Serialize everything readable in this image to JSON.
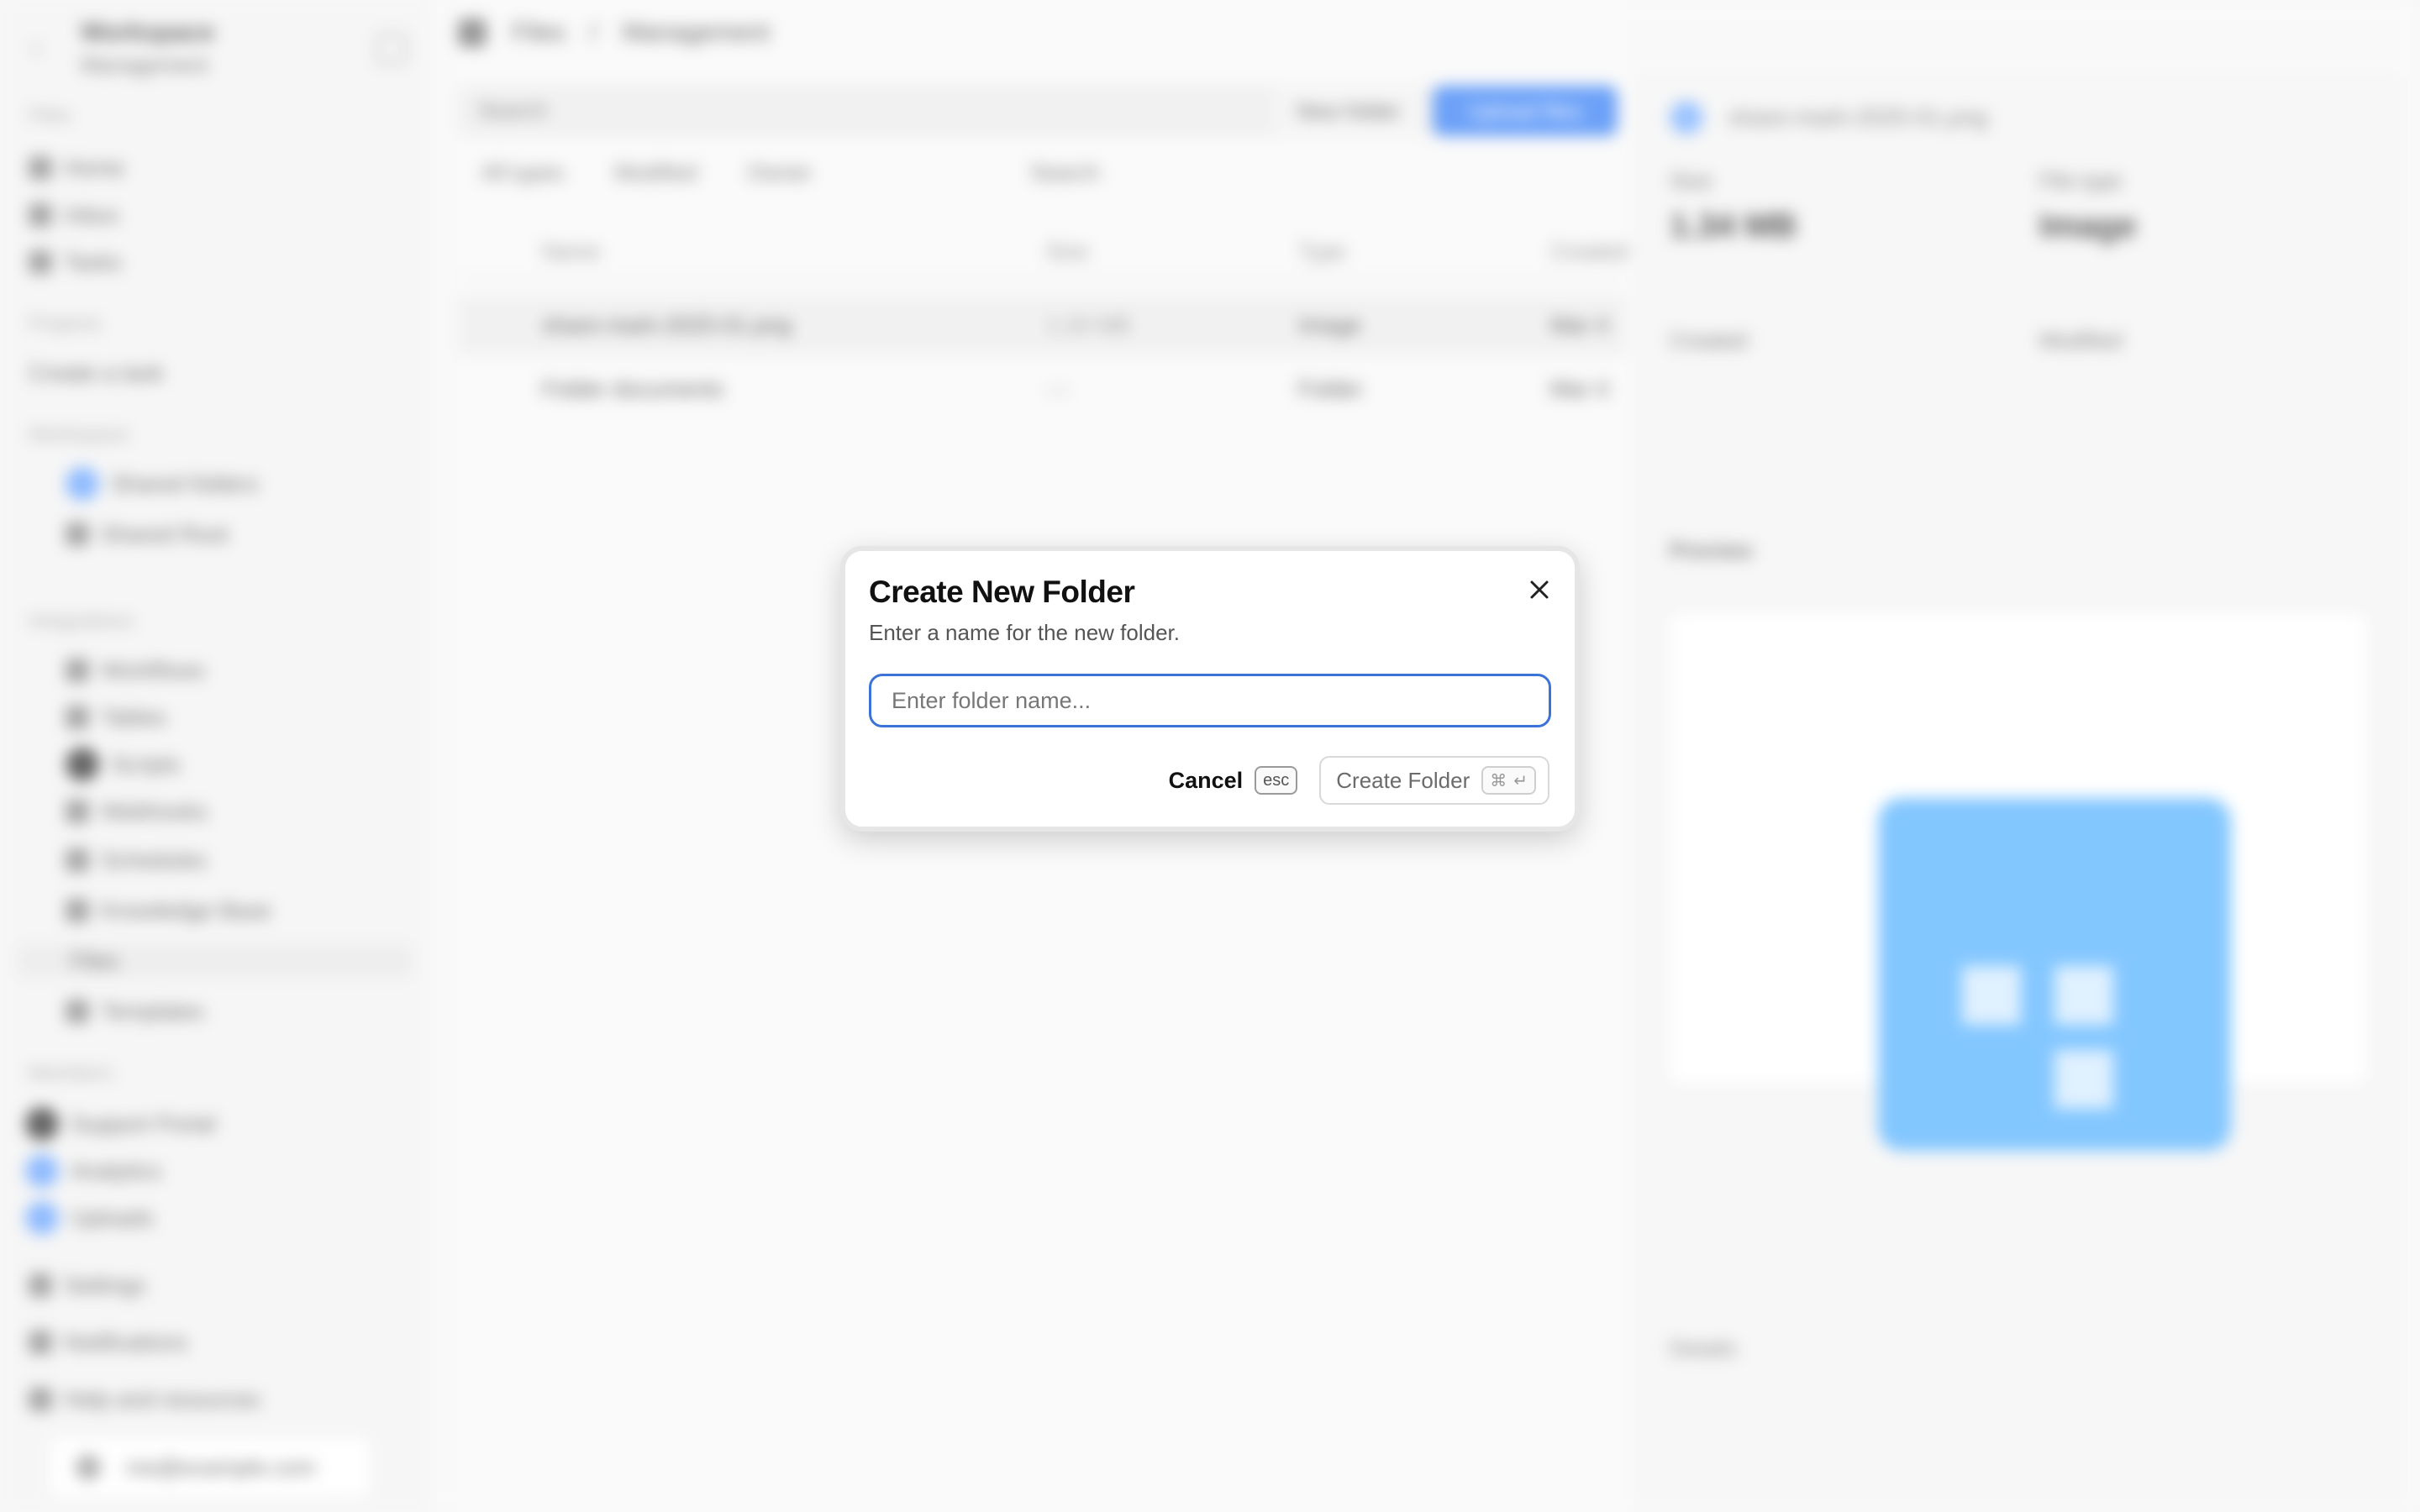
{
  "background": {
    "sidebar": {
      "org_name": "Workspace",
      "org_sub": "Management",
      "sections": [
        "Files",
        "Projects",
        "Workspace",
        "Integrations",
        "Members"
      ],
      "items": [
        "Home",
        "Inbox",
        "Tasks",
        "Create a task",
        "Shared folders",
        "Shared Root",
        "Workflows",
        "Tables",
        "Scripts",
        "Webhooks",
        "Schedules",
        "Knowledge Base",
        "Files",
        "Templates",
        "Support Portal",
        "Analytics",
        "Uploads",
        "Settings",
        "Notifications",
        "Help and resources"
      ],
      "user": "me@example.com"
    },
    "main": {
      "breadcrumb": [
        "Files",
        "Management"
      ],
      "search_placeholder": "Search",
      "toolbar_ghost": "New folder",
      "toolbar_primary": "Upload files",
      "filters": [
        "All types",
        "Modified",
        "Owner",
        "Search"
      ],
      "columns": [
        "Name",
        "Size",
        "Type",
        "Created"
      ],
      "rows": [
        {
          "name": "share-mark-2025-01.png",
          "size": "1.34 MB",
          "type": "Image",
          "created": "Mar 4"
        },
        {
          "name": "Folder documents",
          "size": "—",
          "type": "Folder",
          "created": "Mar 4"
        }
      ]
    },
    "panel": {
      "title": "share-mark-2025-01.png",
      "size_label": "Size",
      "size_value": "1.34 MB",
      "type_label": "File type",
      "type_value": "Image",
      "created_label": "Created",
      "modified_label": "Modified",
      "preview_label": "Preview",
      "details_label": "Details"
    }
  },
  "modal": {
    "title": "Create New Folder",
    "description": "Enter a name for the new folder.",
    "input": {
      "value": "",
      "placeholder": "Enter folder name..."
    },
    "cancel_label": "Cancel",
    "cancel_shortcut": "esc",
    "create_label": "Create Folder",
    "create_shortcut_mod": "⌘",
    "create_shortcut_key": "↵"
  },
  "colors": {
    "accent": "#3b73d6",
    "primary_button": "#3b82f6",
    "preview_icon": "#5ab4ff"
  }
}
